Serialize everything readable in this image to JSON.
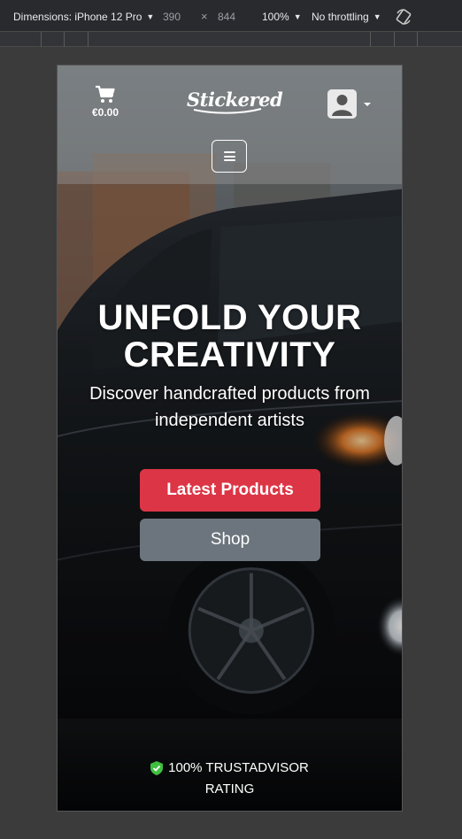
{
  "devtools": {
    "dimensions_label": "Dimensions: iPhone 12 Pro",
    "width": "390",
    "times": "×",
    "height": "844",
    "zoom": "100%",
    "throttling": "No throttling"
  },
  "header": {
    "cart_total": "€0.00",
    "logo_text": "Stickered"
  },
  "hero": {
    "title_line1": "UNFOLD YOUR",
    "title_line2": "CREATIVITY",
    "subtitle_line1": "Discover handcrafted products from",
    "subtitle_line2": "independent artists",
    "latest_button": "Latest Products",
    "shop_button": "Shop"
  },
  "trust": {
    "line1": "100% TRUSTADVISOR",
    "line2": "RATING"
  },
  "colors": {
    "primary_button": "#dc3545",
    "secondary_button": "#6c757d",
    "shield": "#3fbf3f"
  },
  "icons": [
    "caret-down-icon",
    "rotate-icon",
    "cart-icon",
    "user-avatar-icon",
    "hamburger-icon",
    "shield-check-icon"
  ]
}
